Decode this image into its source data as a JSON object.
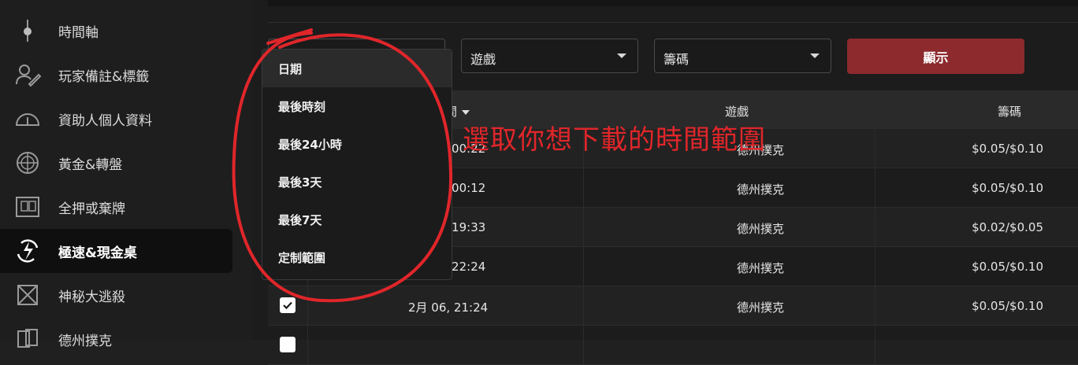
{
  "sidebar": {
    "items": [
      {
        "label": "時間軸",
        "icon": "timeline-icon",
        "active": false
      },
      {
        "label": "玩家備註&標籤",
        "icon": "player-notes-icon",
        "active": false
      },
      {
        "label": "資助人個人資料",
        "icon": "speedometer-icon",
        "active": false
      },
      {
        "label": "黃金&轉盤",
        "icon": "wheel-icon",
        "active": false
      },
      {
        "label": "全押或棄牌",
        "icon": "allin-fold-icon",
        "active": false
      },
      {
        "label": "極速&現金桌",
        "icon": "rush-cash-icon",
        "active": true
      },
      {
        "label": "神秘大逃殺",
        "icon": "mystery-battle-icon",
        "active": false
      },
      {
        "label": "德州撲克",
        "icon": "cards-icon",
        "active": false
      }
    ]
  },
  "filters": {
    "date_select": {
      "value": ""
    },
    "game_select": {
      "value": "遊戲"
    },
    "stakes_select": {
      "value": "籌碼"
    },
    "show_button": "顯示"
  },
  "dropdown": {
    "options": [
      "日期",
      "最後時刻",
      "最後24小時",
      "最後3天",
      "最後7天",
      "定制範圍"
    ],
    "selected_index": 0
  },
  "table": {
    "columns": {
      "date": "間",
      "game": "遊戲",
      "stakes": "籌碼"
    },
    "rows": [
      {
        "date": ":00:22",
        "game": "德州撲克",
        "stakes": "$0.05/$0.10",
        "checked": false
      },
      {
        "date": ":00:12",
        "game": "德州撲克",
        "stakes": "$0.05/$0.10",
        "checked": false
      },
      {
        "date": ":19:33",
        "game": "德州撲克",
        "stakes": "$0.02/$0.05",
        "checked": false
      },
      {
        "date": ":22:24",
        "game": "德州撲克",
        "stakes": "$0.05/$0.10",
        "checked": false
      },
      {
        "date": "2月 06, 21:24",
        "game": "德州撲克",
        "stakes": "$0.05/$0.10",
        "checked": true
      }
    ]
  },
  "annotation": {
    "text": "選取你想下載的時間範圍",
    "color": "#e0262a"
  },
  "colors": {
    "accent_button": "#8c2a2e",
    "sidebar_bg": "#1e1e1e",
    "main_bg": "#1c1c1c"
  }
}
